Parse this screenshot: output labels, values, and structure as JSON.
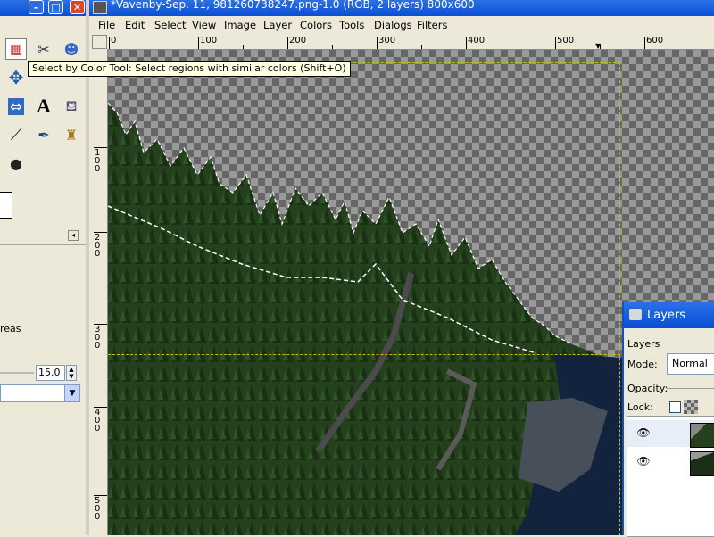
{
  "toolbox": {
    "tools": [
      {
        "name": "select-by-color-tool-icon",
        "glyph": "▦"
      },
      {
        "name": "scissors-select-tool-icon",
        "glyph": "✂"
      },
      {
        "name": "foreground-select-tool-icon",
        "glyph": "☻"
      },
      {
        "name": "move-tool-icon",
        "glyph": "✥"
      },
      {
        "name": "flip-tool-icon",
        "glyph": "⇔"
      },
      {
        "name": "text-tool-icon",
        "glyph": "A"
      },
      {
        "name": "bucket-fill-tool-icon",
        "glyph": "⛾"
      },
      {
        "name": "color-picker-tool-icon",
        "glyph": "⟋"
      },
      {
        "name": "ink-tool-icon",
        "glyph": "✒"
      },
      {
        "name": "clone-tool-icon",
        "glyph": "♜"
      },
      {
        "name": "smudge-tool-icon",
        "glyph": "●"
      }
    ],
    "options_partial_text": "reas",
    "threshold_value": "15.0"
  },
  "image_window": {
    "title": "*Vavenby-Sep. 11, 981260738247.png-1.0 (RGB, 2 layers) 800x600",
    "menu": [
      "File",
      "Edit",
      "Select",
      "View",
      "Image",
      "Layer",
      "Colors",
      "Tools",
      "Dialogs",
      "Filters"
    ],
    "ruler_h_labels": [
      "0",
      "100",
      "200",
      "300",
      "400",
      "500",
      "600"
    ],
    "ruler_v_labels": [
      "1 0 0",
      "2 0 0",
      "3 0 0",
      "4 0 0",
      "5 0 0"
    ]
  },
  "tooltip": "Select by Color Tool: Select regions with similar colors  (Shift+O)",
  "layers_dialog": {
    "title": "Layers",
    "section_label": "Layers",
    "mode_label": "Mode:",
    "mode_value": "Normal",
    "opacity_label": "Opacity:",
    "lock_label": "Lock:"
  },
  "colors": {
    "titlebar_blue": "#0a4fd4",
    "tooltip_bg": "#ffffe1",
    "guide_yellow": "#c8c300",
    "forest_green": "#24401d",
    "water_blue": "#13233d"
  }
}
